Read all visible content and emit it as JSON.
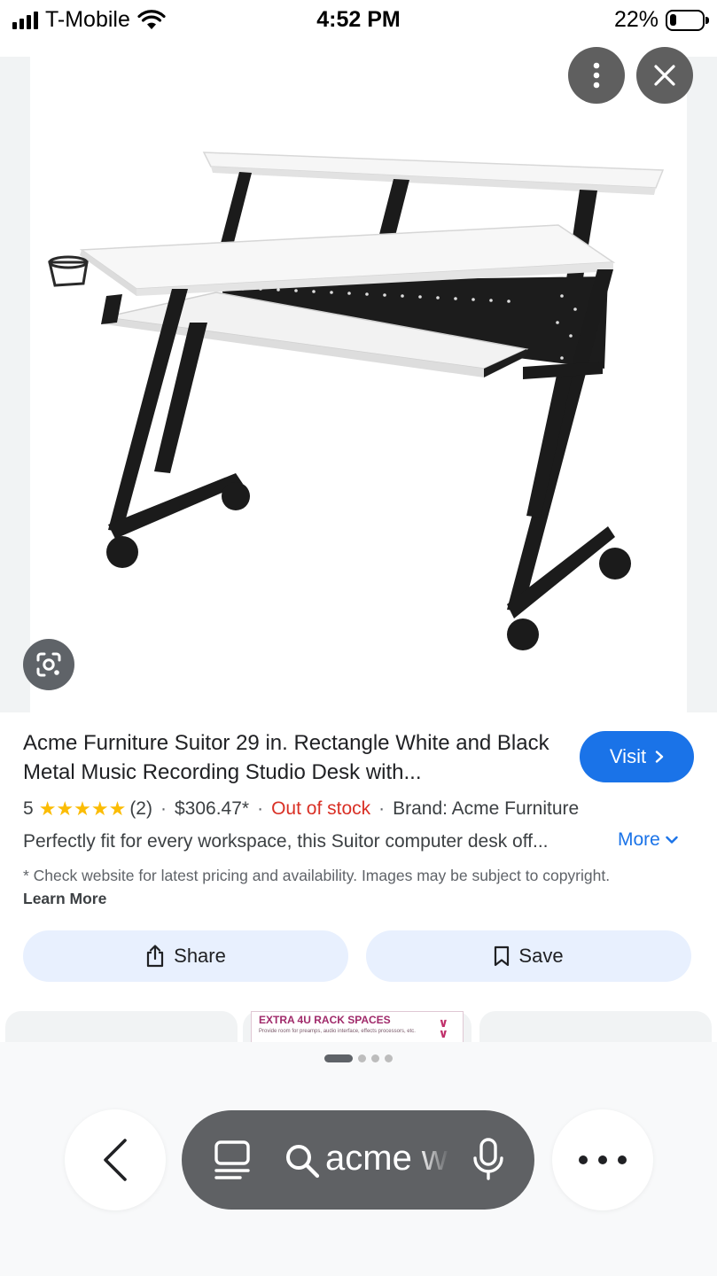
{
  "status_bar": {
    "carrier": "T-Mobile",
    "time": "4:52 PM",
    "battery_percent": "22%",
    "battery_level": 0.22,
    "icons": [
      "signal-icon",
      "wifi-icon",
      "battery-icon"
    ]
  },
  "image_controls": {
    "icons": [
      "more-vert-icon",
      "close-icon",
      "lens-icon"
    ]
  },
  "product": {
    "title": "Acme Furniture Suitor 29 in. Rectangle White and Black Metal Music Recording Studio Desk with...",
    "visit_label": "Visit",
    "rating": "5",
    "stars": "★★★★★",
    "rating_value": 5,
    "review_count": "(2)",
    "separator": "·",
    "price": "$306.47*",
    "stock": "Out of stock",
    "brand": "Brand: Acme Furniture",
    "description": "Perfectly fit for every workspace, this Suitor computer desk off...",
    "more_label": "More",
    "disclaimer": "* Check website for latest pricing and availability. Images may be subject to copyright.",
    "learn_more": "Learn More"
  },
  "actions": {
    "share_label": "Share",
    "save_label": "Save"
  },
  "carousel": {
    "ad_title": "EXTRA 4U RACK SPACES",
    "ad_text": "Provide room for preamps, audio interface, effects processors, etc."
  },
  "bottom_bar": {
    "search_query": "acme w",
    "icons": [
      "back-icon",
      "tabs-icon",
      "search-icon",
      "mic-icon",
      "more-horiz-icon"
    ]
  },
  "colors": {
    "accent": "#1a73e8",
    "out_of_stock": "#d93025",
    "stars": "#fbbc04",
    "action_bg": "#e8f0fe"
  }
}
